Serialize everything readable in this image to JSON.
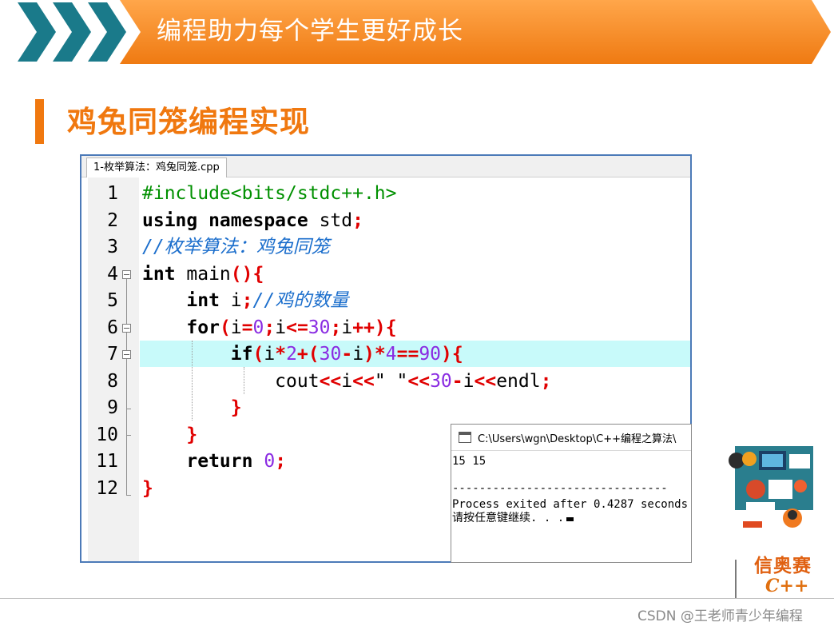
{
  "header": {
    "title": "编程助力每个学生更好成长"
  },
  "section": {
    "title": "鸡兔同笼编程实现"
  },
  "editor": {
    "tab_label": "1-枚举算法：鸡兔同笼.cpp",
    "line_numbers": [
      "1",
      "2",
      "3",
      "4",
      "5",
      "6",
      "7",
      "8",
      "9",
      "10",
      "11",
      "12"
    ],
    "code": {
      "l1": "#include<bits/stdc++.h>",
      "l2a": "using namespace",
      "l2b": " std",
      "l2c": ";",
      "l3": "//枚举算法：鸡兔同笼",
      "l4a": "int",
      "l4b": " main",
      "l4c": "(){",
      "l5a": "int",
      "l5b": " i",
      "l5c": ";",
      "l5d": "//鸡的数量",
      "l6a": "for",
      "l6b": "(",
      "l6c": "i",
      "l6d": "=",
      "l6e": "0",
      "l6f": ";",
      "l6g": "i",
      "l6h": "<=",
      "l6i": "30",
      "l6j": ";",
      "l6k": "i",
      "l6l": "++){",
      "l7a": "if",
      "l7b": "(",
      "l7c": "i",
      "l7d": "*",
      "l7e": "2",
      "l7f": "+(",
      "l7g": "30",
      "l7h": "-",
      "l7i": "i",
      "l7j": ")*",
      "l7k": "4",
      "l7l": "==",
      "l7m": "90",
      "l7n": "){",
      "l8a": "cout",
      "l8b": "<<",
      "l8c": "i",
      "l8d": "<<",
      "l8e": "\" \"",
      "l8f": "<<",
      "l8g": "30",
      "l8h": "-",
      "l8i": "i",
      "l8j": "<<",
      "l8k": "endl",
      "l8l": ";",
      "l9": "}",
      "l10": "}",
      "l11a": "return",
      "l11b": " 0",
      "l11c": ";",
      "l12": "}"
    }
  },
  "console": {
    "title": "C:\\Users\\wgn\\Desktop\\C++编程之算法\\",
    "output_line1": "15 15",
    "separator": "--------------------------------",
    "process_line": "Process exited after 0.4287 seconds",
    "prompt_line": "请按任意键继续. . ."
  },
  "logo": {
    "text_line1": "信奥赛",
    "text_line2": "C++"
  },
  "watermark": {
    "text": "CSDN @王老师青少年编程"
  },
  "colors": {
    "accent_orange": "#f0780f",
    "chevron_teal": "#1a7a8a",
    "editor_border": "#4c7ab8",
    "highlight": "#c8fafa"
  }
}
